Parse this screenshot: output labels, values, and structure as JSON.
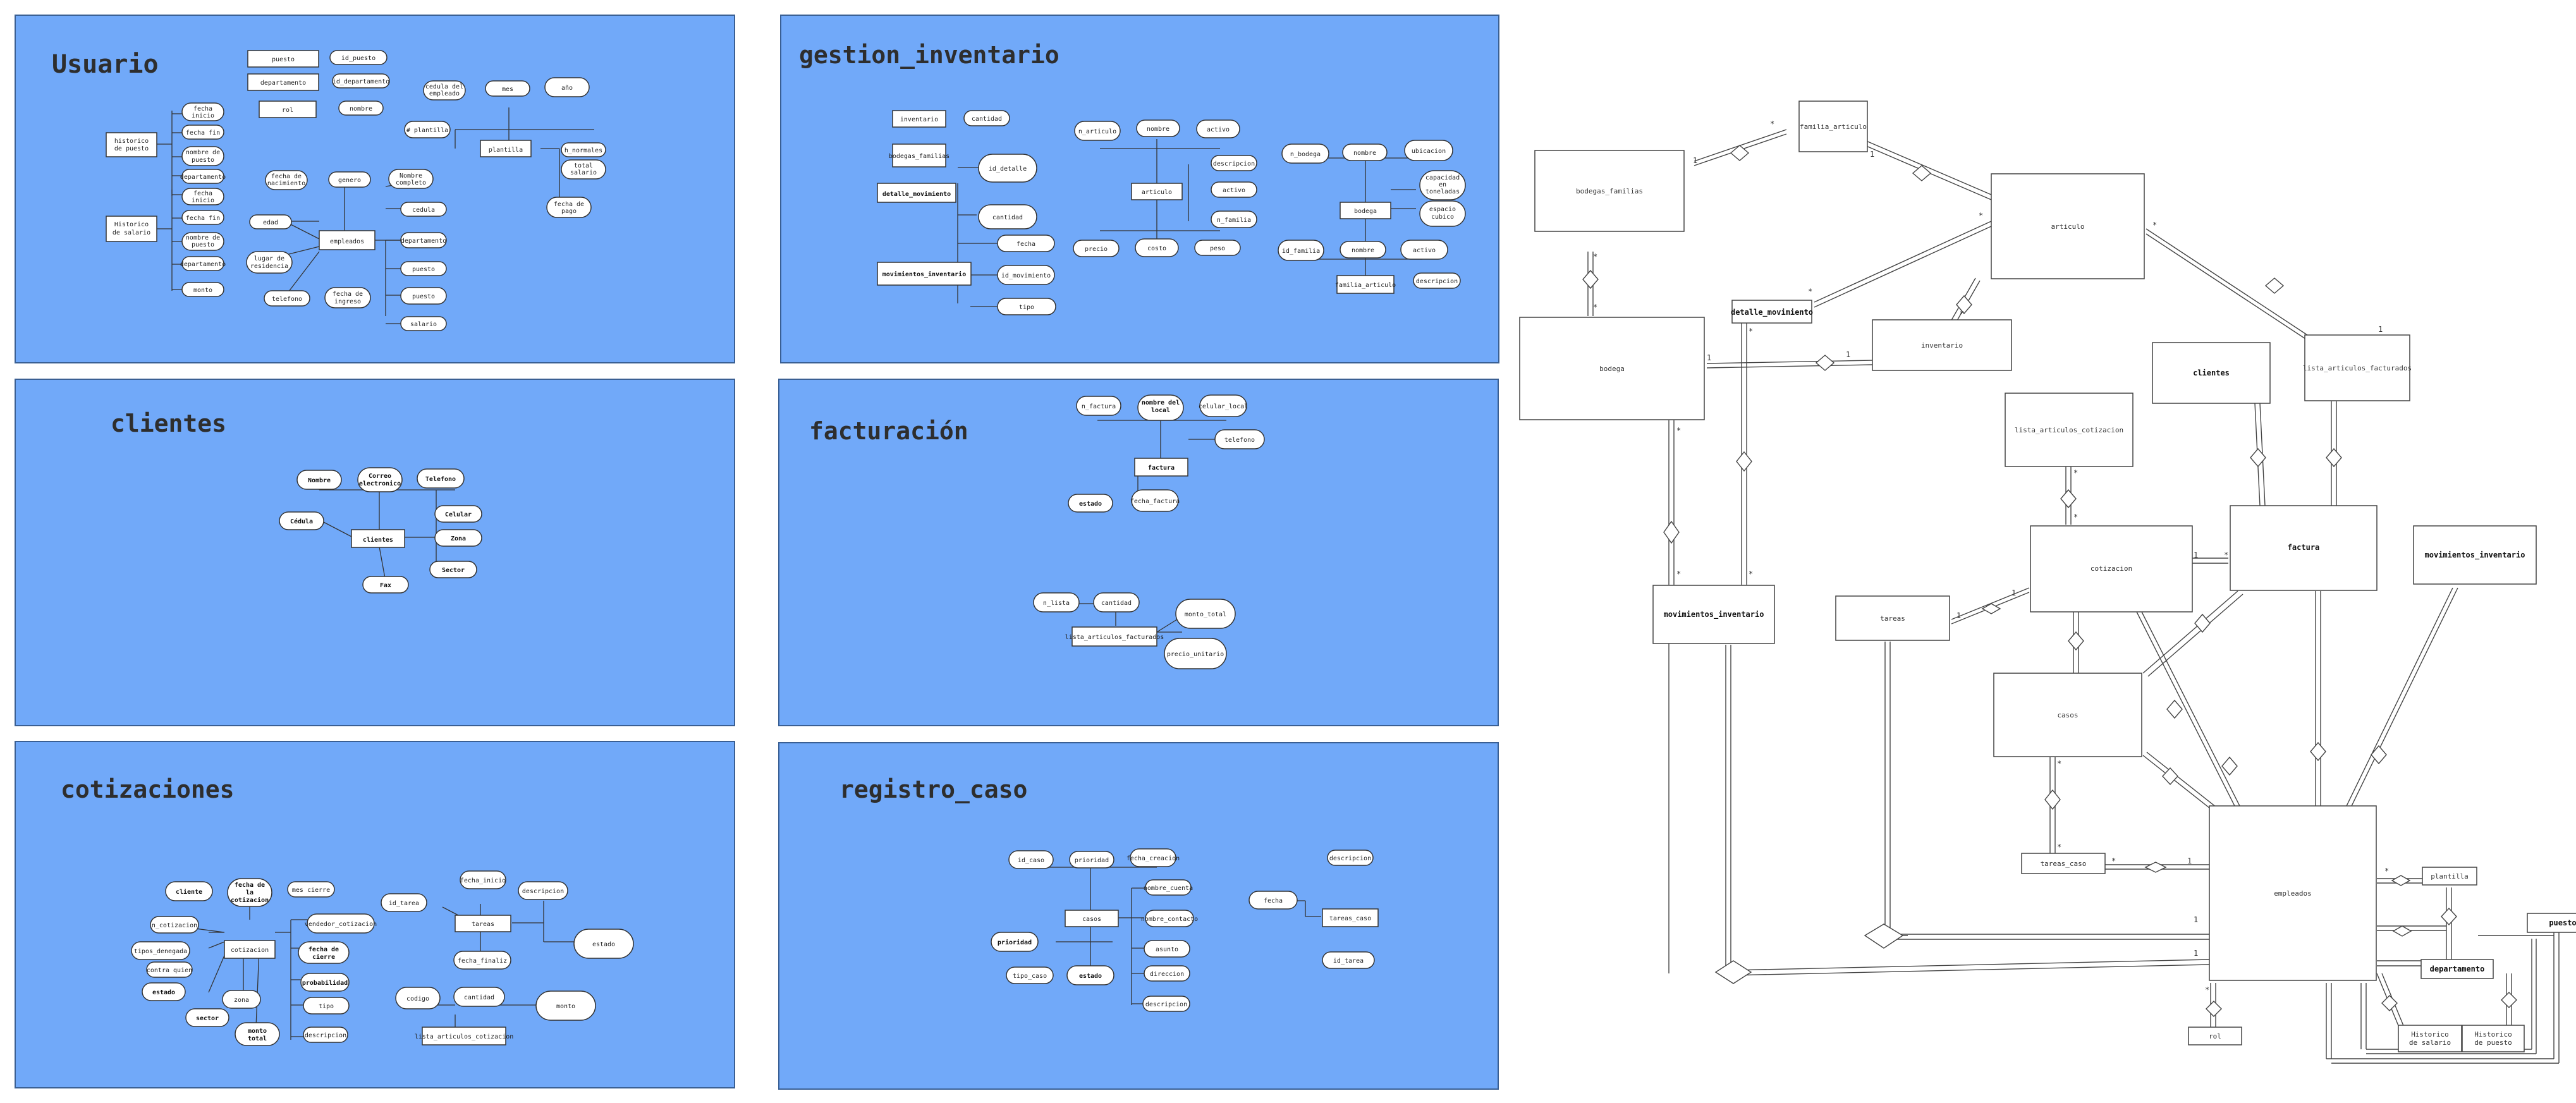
{
  "panels": {
    "usuario": {
      "title": "Usuario",
      "boxes": [
        "puesto",
        "id_puesto",
        "departamento",
        "id_departamento",
        "rol",
        "nombre",
        "Historico de puesto",
        "Historico de salario",
        "plantilla"
      ],
      "ovals": [
        "fecha inicio",
        "fecha fin",
        "nombre de puesto",
        "departamento",
        "fecha inicio",
        "fecha fin",
        "nombre de puesto",
        "departamento",
        "monto",
        "cedula del empleado",
        "mes",
        "año",
        "# plantilla",
        "h_normales",
        "total salario",
        "fecha de pago",
        "fecha de nacimiento",
        "genero",
        "Nombre completo",
        "edad",
        "cedula",
        "departamento",
        "lugar de residencia",
        "puesto",
        "telefono",
        "fecha de ingreso",
        "puesto",
        "salario"
      ],
      "center": "empleados"
    },
    "gestion": {
      "title": "gestion_inventario",
      "boxes": [
        "inventario",
        "bodegas_familias",
        "detalle_movimiento",
        "movimientos_inventario",
        "articulo",
        "bodega",
        "familia_articulo"
      ],
      "ovals": [
        "cantidad",
        "id_detalle",
        "cantidad",
        "fecha",
        "id_movimiento",
        "tipo",
        "n_articulo",
        "nombre",
        "activo",
        "descripcion",
        "activo",
        "n_familia",
        "precio",
        "costo",
        "peso",
        "n_bodega",
        "nombre",
        "ubicacion",
        "capacidad en toneladas",
        "espacio cubico",
        "id_familia",
        "nombre",
        "activo",
        "descripcion"
      ]
    },
    "clientes": {
      "title": "clientes",
      "center": "clientes",
      "ovals": [
        "Nombre",
        "Correo electronico",
        "Telefono",
        "Cédula",
        "Celular",
        "Zona",
        "Sector",
        "Fax"
      ]
    },
    "facturacion": {
      "title": "facturación",
      "center": "factura",
      "ovals": [
        "n_factura",
        "nombre del local",
        "celular_local",
        "telefono",
        "estado",
        "fecha_factura",
        "n_lista",
        "cantidad",
        "monto_total",
        "precio_unitario"
      ],
      "box2": "lista_articulos_facturados"
    },
    "cotizaciones": {
      "title": "cotizaciones",
      "center": "cotizacion",
      "ovals": [
        "cliente",
        "fecha de la cotizacion",
        "mes cierre",
        "n_cotizacion",
        "tipos_denegada",
        "contra quien",
        "estado",
        "vendedor_cotizacion",
        "fecha de cierre",
        "probabilidad",
        "tipo",
        "descripcion",
        "zona",
        "sector",
        "monto total",
        "id_tarea",
        "fecha_inicio",
        "descripcion",
        "fecha_finaliz",
        "estado",
        "codigo",
        "cantidad",
        "monto"
      ],
      "boxes": [
        "tareas",
        "lista_articulos_cotizacion"
      ]
    },
    "registro": {
      "title": "registro_caso",
      "center": "casos",
      "ovals": [
        "id_caso",
        "prioridad",
        "fecha_creacion",
        "nombre_cuenta",
        "nombre_contacto",
        "asunto",
        "direccion",
        "descripcion",
        "prioridad",
        "tipo_caso",
        "estado",
        "descripcion",
        "fecha",
        "id_tarea"
      ],
      "boxes": [
        "tareas_caso"
      ]
    }
  },
  "er": {
    "entities": [
      "bodegas_familias",
      "familia_articulo",
      "articulo",
      "bodega",
      "detalle_movimiento",
      "inventario",
      "clientes",
      "lista_articulos_facturados",
      "lista_articulos_cotizacion",
      "cotizacion",
      "factura",
      "movimientos_inventario",
      "movimientos_inventario",
      "tareas",
      "casos",
      "tareas_caso",
      "empleados",
      "rol",
      "plantilla",
      "puesto",
      "departamento",
      "Historico de salario",
      "Historico de puesto"
    ],
    "cards": [
      "1",
      "*",
      "1",
      "*",
      "1",
      "1",
      "*",
      "*",
      "*",
      "*",
      "*",
      "1",
      "1",
      "*",
      "*",
      "*",
      "*",
      "*",
      "*",
      "*",
      "*",
      "*",
      "1",
      "1",
      "1",
      "1",
      "1",
      "*",
      "*",
      "*"
    ]
  }
}
